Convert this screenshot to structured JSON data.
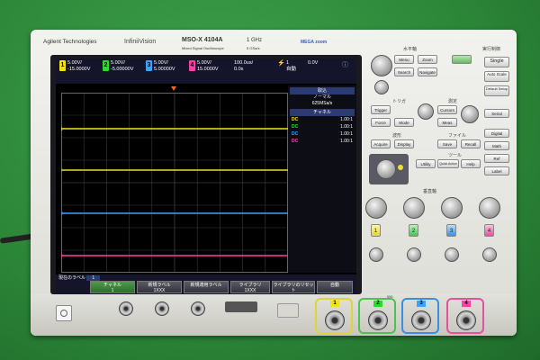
{
  "brand": {
    "maker": "Agilent Technologies",
    "series": "InfiniiVision",
    "model": "MSO-X 4104A",
    "subtitle": "Mixed Signal Oscilloscope",
    "bandwidth": "1 GHz",
    "sample": "5 GSa/s",
    "megazoom": "MEGA zoom"
  },
  "status": {
    "channels": [
      {
        "n": "1",
        "scale": "5.00V/",
        "offset": "-15.0000V",
        "color": "#f2e21c"
      },
      {
        "n": "2",
        "scale": "5.00V/",
        "offset": "-5.00000V",
        "color": "#2ddb2d"
      },
      {
        "n": "3",
        "scale": "5.00V/",
        "offset": "5.00000V",
        "color": "#3aa2ff"
      },
      {
        "n": "4",
        "scale": "5.00V/",
        "offset": "15.0000V",
        "color": "#ff3fa6"
      }
    ],
    "timebase": "100.0us/",
    "delay": "0.0s",
    "trigger_icon": "⚡",
    "trigger_ch": "1",
    "trigger_level": "0.0V",
    "trigger_mode": "自動"
  },
  "side": {
    "acq_header": "取込",
    "acq_mode": "ノーマル",
    "acq_rate": "625MSa/s",
    "ch_header": "チャネル",
    "rows": [
      {
        "c": "DC",
        "v": "1.00:1",
        "color": "#f2e21c"
      },
      {
        "c": "DC",
        "v": "1.00:1",
        "color": "#2ddb2d"
      },
      {
        "c": "DC",
        "v": "1.00:1",
        "color": "#3aa2ff"
      },
      {
        "c": "DC",
        "v": "1.00:1",
        "color": "#ff3fa6"
      }
    ]
  },
  "softkeys": {
    "title": "現在のラベル",
    "title_value": "1",
    "keys": [
      {
        "top": "チャネル",
        "bot": "1"
      },
      {
        "top": "新規ラベル",
        "bot": "1XXX"
      },
      {
        "top": "新規適用ラベル",
        "bot": ""
      },
      {
        "top": "ライブラリ",
        "bot": "1XXX"
      },
      {
        "top": "ライブラリのリセット",
        "bot": ""
      },
      {
        "top": "自動",
        "bot": ""
      }
    ]
  },
  "panel": {
    "horizontal": "水平軸",
    "run_control": "実行制御",
    "single": "Single",
    "auto_scale": "Auto Scale",
    "default_setup": "Default Setup",
    "trigger": "トリガ",
    "measure": "測定",
    "waveform": "波形",
    "file": "ファイル",
    "tools": "ツール",
    "vertical": "垂直軸",
    "buttons": [
      "Menu",
      "Search",
      "Zoom",
      "Navigate",
      "Trigger",
      "Force",
      "Mode",
      "Level",
      "Cursors",
      "Meas",
      "Acquire",
      "Display",
      "Save",
      "Recall",
      "Utility",
      "Quick Action",
      "Help",
      "Digital",
      "Math",
      "Ref",
      "Label",
      "Serial"
    ]
  },
  "front": {
    "channel_labels": [
      "1",
      "2",
      "3",
      "4"
    ],
    "input_note": "50Ω"
  }
}
